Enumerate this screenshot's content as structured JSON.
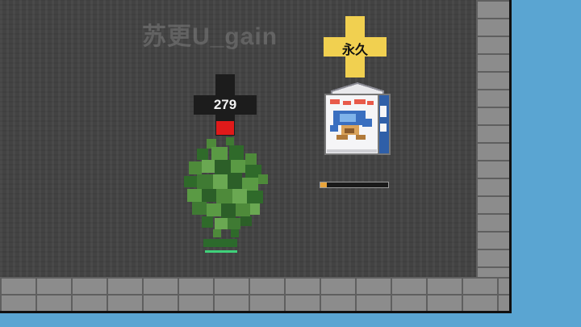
{
  "watermark": "苏更U_gain",
  "enemy": {
    "hp_value": "279",
    "sprite": "leaf-bush"
  },
  "item": {
    "label": "永久",
    "sprite": "milk-carton",
    "progress_fraction": 0.1
  },
  "colors": {
    "sky": "#5aa5d2",
    "floor": "#434343",
    "wall": "#8c8c8c",
    "gold": "#f1d050",
    "hp_red": "#e01a1a",
    "progress_fill": "#e8a43c"
  }
}
